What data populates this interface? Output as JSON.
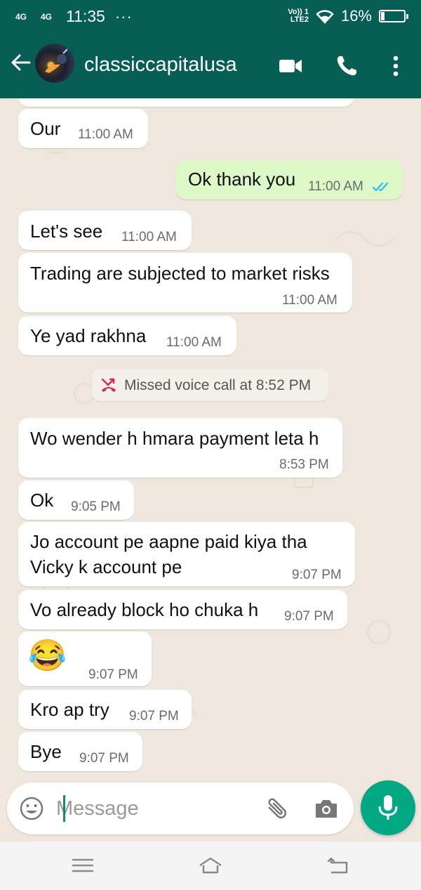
{
  "status": {
    "signal1": "4G",
    "signal2": "4G",
    "time": "11:35",
    "more": "···",
    "volte": "Vo)) 1",
    "lte": "LTE2",
    "battery": "16%",
    "battery_level": 0.16
  },
  "header": {
    "contact_name": "classiccapitalusa",
    "back_icon": "arrow-left-icon",
    "video_icon": "video-camera-icon",
    "call_icon": "phone-icon",
    "menu_icon": "more-vertical-icon"
  },
  "messages": [
    {
      "dir": "in",
      "text": "Our",
      "time": "11:00 AM"
    },
    {
      "dir": "out",
      "text": "Ok thank you",
      "time": "11:00 AM",
      "read": true
    },
    {
      "dir": "in",
      "text": "Let's see",
      "time": "11:00 AM"
    },
    {
      "dir": "in",
      "text": "Trading are subjected to market risks",
      "time": "11:00 AM"
    },
    {
      "dir": "in",
      "text": "Ye yad rakhna",
      "time": "11:00 AM"
    },
    {
      "dir": "system",
      "text": "Missed voice call at 8:52 PM"
    },
    {
      "dir": "in",
      "text": "Wo wender h hmara payment leta h",
      "time": "8:53 PM"
    },
    {
      "dir": "in",
      "text": "Ok",
      "time": "9:05 PM"
    },
    {
      "dir": "in",
      "text": "Jo account pe aapne paid kiya tha",
      "text2": "Vicky k account pe",
      "time": "9:07 PM"
    },
    {
      "dir": "in",
      "text": "Vo already block ho chuka h",
      "time": "9:07 PM"
    },
    {
      "dir": "in",
      "emoji": "😂",
      "time": "9:07 PM"
    },
    {
      "dir": "in",
      "text": "Kro ap try",
      "time": "9:07 PM"
    },
    {
      "dir": "in",
      "text": "Bye",
      "time": "9:07 PM"
    }
  ],
  "input": {
    "placeholder": "Message",
    "emoji_icon": "emoji-icon",
    "attach_icon": "paperclip-icon",
    "camera_icon": "camera-icon",
    "mic_icon": "microphone-icon"
  },
  "colors": {
    "header": "#075e54",
    "outgoing_bubble": "#dcf8c6",
    "incoming_bubble": "#ffffff",
    "accent": "#00a884",
    "read_ticks": "#34b7f1",
    "missed_call": "#e0245e"
  },
  "nav": {
    "menu_icon": "menu-icon",
    "home_icon": "home-icon",
    "back_icon": "back-icon"
  }
}
